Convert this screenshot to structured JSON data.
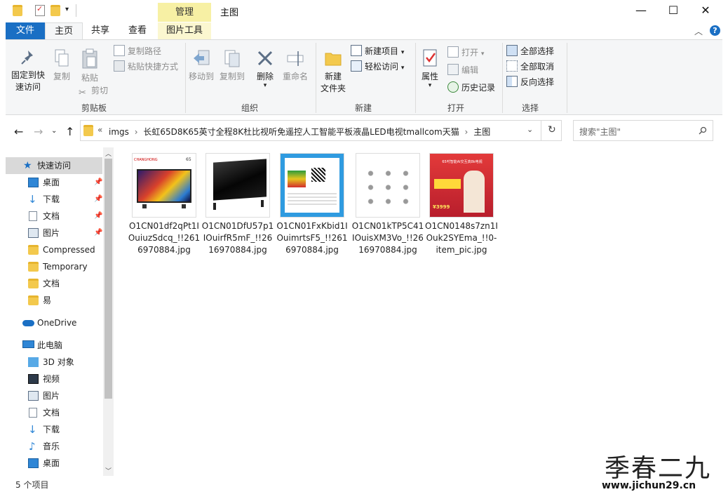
{
  "window": {
    "title": "主图",
    "contextual_tab": "管理",
    "minimize": "—",
    "maximize": "☐",
    "close": "✕"
  },
  "tabs": {
    "file": "文件",
    "home": "主页",
    "share": "共享",
    "view": "查看",
    "picture_tools": "图片工具"
  },
  "ribbon": {
    "clipboard": {
      "label": "剪贴板",
      "pin_line1": "固定到快",
      "pin_line2": "速访问",
      "copy": "复制",
      "paste": "粘贴",
      "copy_path": "复制路径",
      "paste_shortcut": "粘贴快捷方式",
      "cut": "剪切"
    },
    "organize": {
      "label": "组织",
      "move_to": "移动到",
      "copy_to": "复制到",
      "delete": "删除",
      "rename": "重命名"
    },
    "new": {
      "label": "新建",
      "new_folder_line1": "新建",
      "new_folder_line2": "文件夹",
      "new_item": "新建项目",
      "easy_access": "轻松访问"
    },
    "open": {
      "label": "打开",
      "properties": "属性",
      "open": "打开",
      "edit": "编辑",
      "history": "历史记录"
    },
    "select": {
      "label": "选择",
      "select_all": "全部选择",
      "select_none": "全部取消",
      "invert": "反向选择"
    }
  },
  "address": {
    "prefix": "«",
    "path": [
      "imgs",
      "长虹65D8K65英寸全程8K杜比视听免遥控人工智能平板液晶LED电视tmallcom天猫",
      "主图"
    ],
    "search_placeholder": "搜索\"主图\""
  },
  "nav": {
    "quick_access": "快速访问",
    "items": [
      "桌面",
      "下载",
      "文档",
      "图片",
      "Compressed",
      "Temporary",
      "文档",
      "易"
    ],
    "onedrive": "OneDrive",
    "this_pc": "此电脑",
    "pc_items": [
      "3D 对象",
      "视频",
      "图片",
      "文档",
      "下载",
      "音乐",
      "桌面"
    ]
  },
  "files": [
    {
      "name": "O1CN01df2qPt1IOuiuzSdcq_!!2616970884.jpg"
    },
    {
      "name": "O1CN01DfU57p1IOuirfR5mF_!!2616970884.jpg"
    },
    {
      "name": "O1CN01FxKbid1IOuimrtsF5_!!2616970884.jpg"
    },
    {
      "name": "O1CN01kTP5C41IOuisXM3Vo_!!2616970884.jpg"
    },
    {
      "name": "O1CN0148s7zn1IOuk2SYEma_!!0-item_pic.jpg"
    }
  ],
  "thumb_text": {
    "brand": "CHANGHONG",
    "size": "65",
    "promo_title": "65吋智能AI交互真8k电视",
    "promo_price": "¥3999"
  },
  "status": {
    "count": "5 个项目"
  },
  "watermark": {
    "line1": "季春二九",
    "line2": "www.jichun29.cn"
  },
  "colors": {
    "accent": "#1a6fc4",
    "folder": "#f3c94d",
    "manage_tab": "#f7f0a4"
  }
}
